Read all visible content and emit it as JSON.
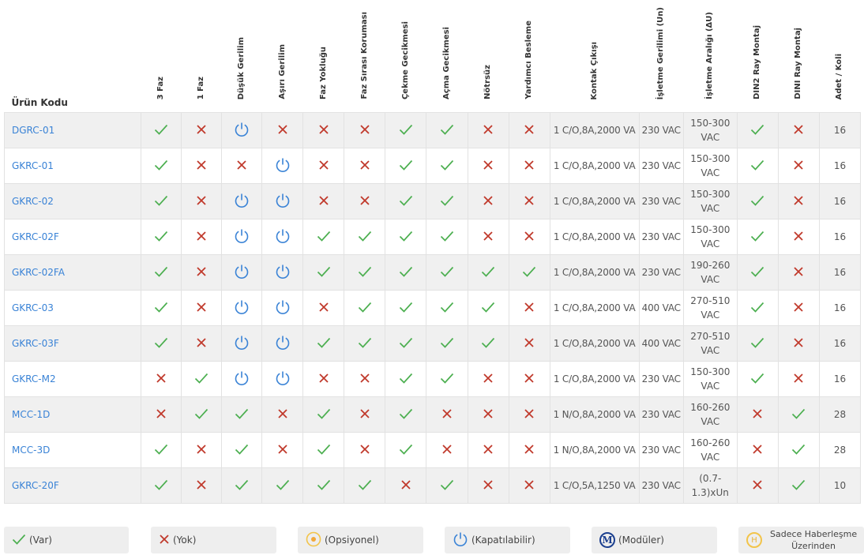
{
  "colors": {
    "check": "#4caf50",
    "cross": "#c0392b",
    "power": "#3a83d6",
    "link": "#3a83d6"
  },
  "headers": [
    "Ürün Kodu",
    "3 Faz",
    "1 Faz",
    "Düşük Gerilim",
    "Aşırı Gerilim",
    "Faz Yokluğu",
    "Faz Sırası Koruması",
    "Çekme Gecikmesi",
    "Açma Gecikmesi",
    "Nötrsüz",
    "Yardımcı Besleme",
    "Kontak Çıkışı",
    "İşletme Gerilimi (Un)",
    "İşletme Aralığı (ΔU)",
    "DIN2 Ray Montaj",
    "DINI Ray Montaj",
    "Adet / Koli"
  ],
  "rows": [
    {
      "code": "DGRC-01",
      "flags": [
        "check",
        "cross",
        "power",
        "cross",
        "cross",
        "cross",
        "check",
        "check",
        "cross",
        "cross"
      ],
      "contact": "1 C/O,8A,2000 VA",
      "voltage": "230 VAC",
      "range": [
        "150-300",
        "VAC"
      ],
      "din2": "check",
      "dini": "cross",
      "qty": "16"
    },
    {
      "code": "GKRC-01",
      "flags": [
        "check",
        "cross",
        "cross",
        "power",
        "cross",
        "cross",
        "check",
        "check",
        "cross",
        "cross"
      ],
      "contact": "1 C/O,8A,2000 VA",
      "voltage": "230 VAC",
      "range": [
        "150-300",
        "VAC"
      ],
      "din2": "check",
      "dini": "cross",
      "qty": "16"
    },
    {
      "code": "GKRC-02",
      "flags": [
        "check",
        "cross",
        "power",
        "power",
        "cross",
        "cross",
        "check",
        "check",
        "cross",
        "cross"
      ],
      "contact": "1 C/O,8A,2000 VA",
      "voltage": "230 VAC",
      "range": [
        "150-300",
        "VAC"
      ],
      "din2": "check",
      "dini": "cross",
      "qty": "16"
    },
    {
      "code": "GKRC-02F",
      "flags": [
        "check",
        "cross",
        "power",
        "power",
        "check",
        "check",
        "check",
        "check",
        "cross",
        "cross"
      ],
      "contact": "1 C/O,8A,2000 VA",
      "voltage": "230 VAC",
      "range": [
        "150-300",
        "VAC"
      ],
      "din2": "check",
      "dini": "cross",
      "qty": "16"
    },
    {
      "code": "GKRC-02FA",
      "flags": [
        "check",
        "cross",
        "power",
        "power",
        "check",
        "check",
        "check",
        "check",
        "check",
        "check"
      ],
      "contact": "1 C/O,8A,2000 VA",
      "voltage": "230 VAC",
      "range": [
        "190-260",
        "VAC"
      ],
      "din2": "check",
      "dini": "cross",
      "qty": "16"
    },
    {
      "code": "GKRC-03",
      "flags": [
        "check",
        "cross",
        "power",
        "power",
        "cross",
        "check",
        "check",
        "check",
        "check",
        "cross"
      ],
      "contact": "1 C/O,8A,2000 VA",
      "voltage": "400 VAC",
      "range": [
        "270-510",
        "VAC"
      ],
      "din2": "check",
      "dini": "cross",
      "qty": "16"
    },
    {
      "code": "GKRC-03F",
      "flags": [
        "check",
        "cross",
        "power",
        "power",
        "check",
        "check",
        "check",
        "check",
        "check",
        "cross"
      ],
      "contact": "1 C/O,8A,2000 VA",
      "voltage": "400 VAC",
      "range": [
        "270-510",
        "VAC"
      ],
      "din2": "check",
      "dini": "cross",
      "qty": "16"
    },
    {
      "code": "GKRC-M2",
      "flags": [
        "cross",
        "check",
        "power",
        "power",
        "cross",
        "cross",
        "check",
        "check",
        "cross",
        "cross"
      ],
      "contact": "1 C/O,8A,2000 VA",
      "voltage": "230 VAC",
      "range": [
        "150-300",
        "VAC"
      ],
      "din2": "check",
      "dini": "cross",
      "qty": "16"
    },
    {
      "code": "MCC-1D",
      "flags": [
        "cross",
        "check",
        "check",
        "cross",
        "check",
        "cross",
        "check",
        "cross",
        "cross",
        "cross"
      ],
      "contact": "1 N/O,8A,2000 VA",
      "voltage": "230 VAC",
      "range": [
        "160-260",
        "VAC"
      ],
      "din2": "cross",
      "dini": "check",
      "qty": "28"
    },
    {
      "code": "MCC-3D",
      "flags": [
        "check",
        "cross",
        "check",
        "cross",
        "check",
        "cross",
        "check",
        "cross",
        "cross",
        "cross"
      ],
      "contact": "1 N/O,8A,2000 VA",
      "voltage": "230 VAC",
      "range": [
        "160-260",
        "VAC"
      ],
      "din2": "cross",
      "dini": "check",
      "qty": "28"
    },
    {
      "code": "GKRC-20F",
      "flags": [
        "check",
        "cross",
        "check",
        "check",
        "check",
        "check",
        "cross",
        "check",
        "cross",
        "cross"
      ],
      "contact": "1 C/O,5A,1250 VA",
      "voltage": "230 VAC",
      "range": [
        "(0.7-",
        "1.3)xUn"
      ],
      "din2": "cross",
      "dini": "check",
      "qty": "10"
    }
  ],
  "legend": {
    "var": "(Var)",
    "yok": "(Yok)",
    "opsiyonel": "(Opsiyonel)",
    "kapatilabilir": "(Kapatılabilir)",
    "moduler": "(Modüler)",
    "haberlesme_line1": "Sadece Haberleşme",
    "haberlesme_line2": "Üzerinden",
    "mod_letter": "M",
    "h_letter": "H"
  }
}
